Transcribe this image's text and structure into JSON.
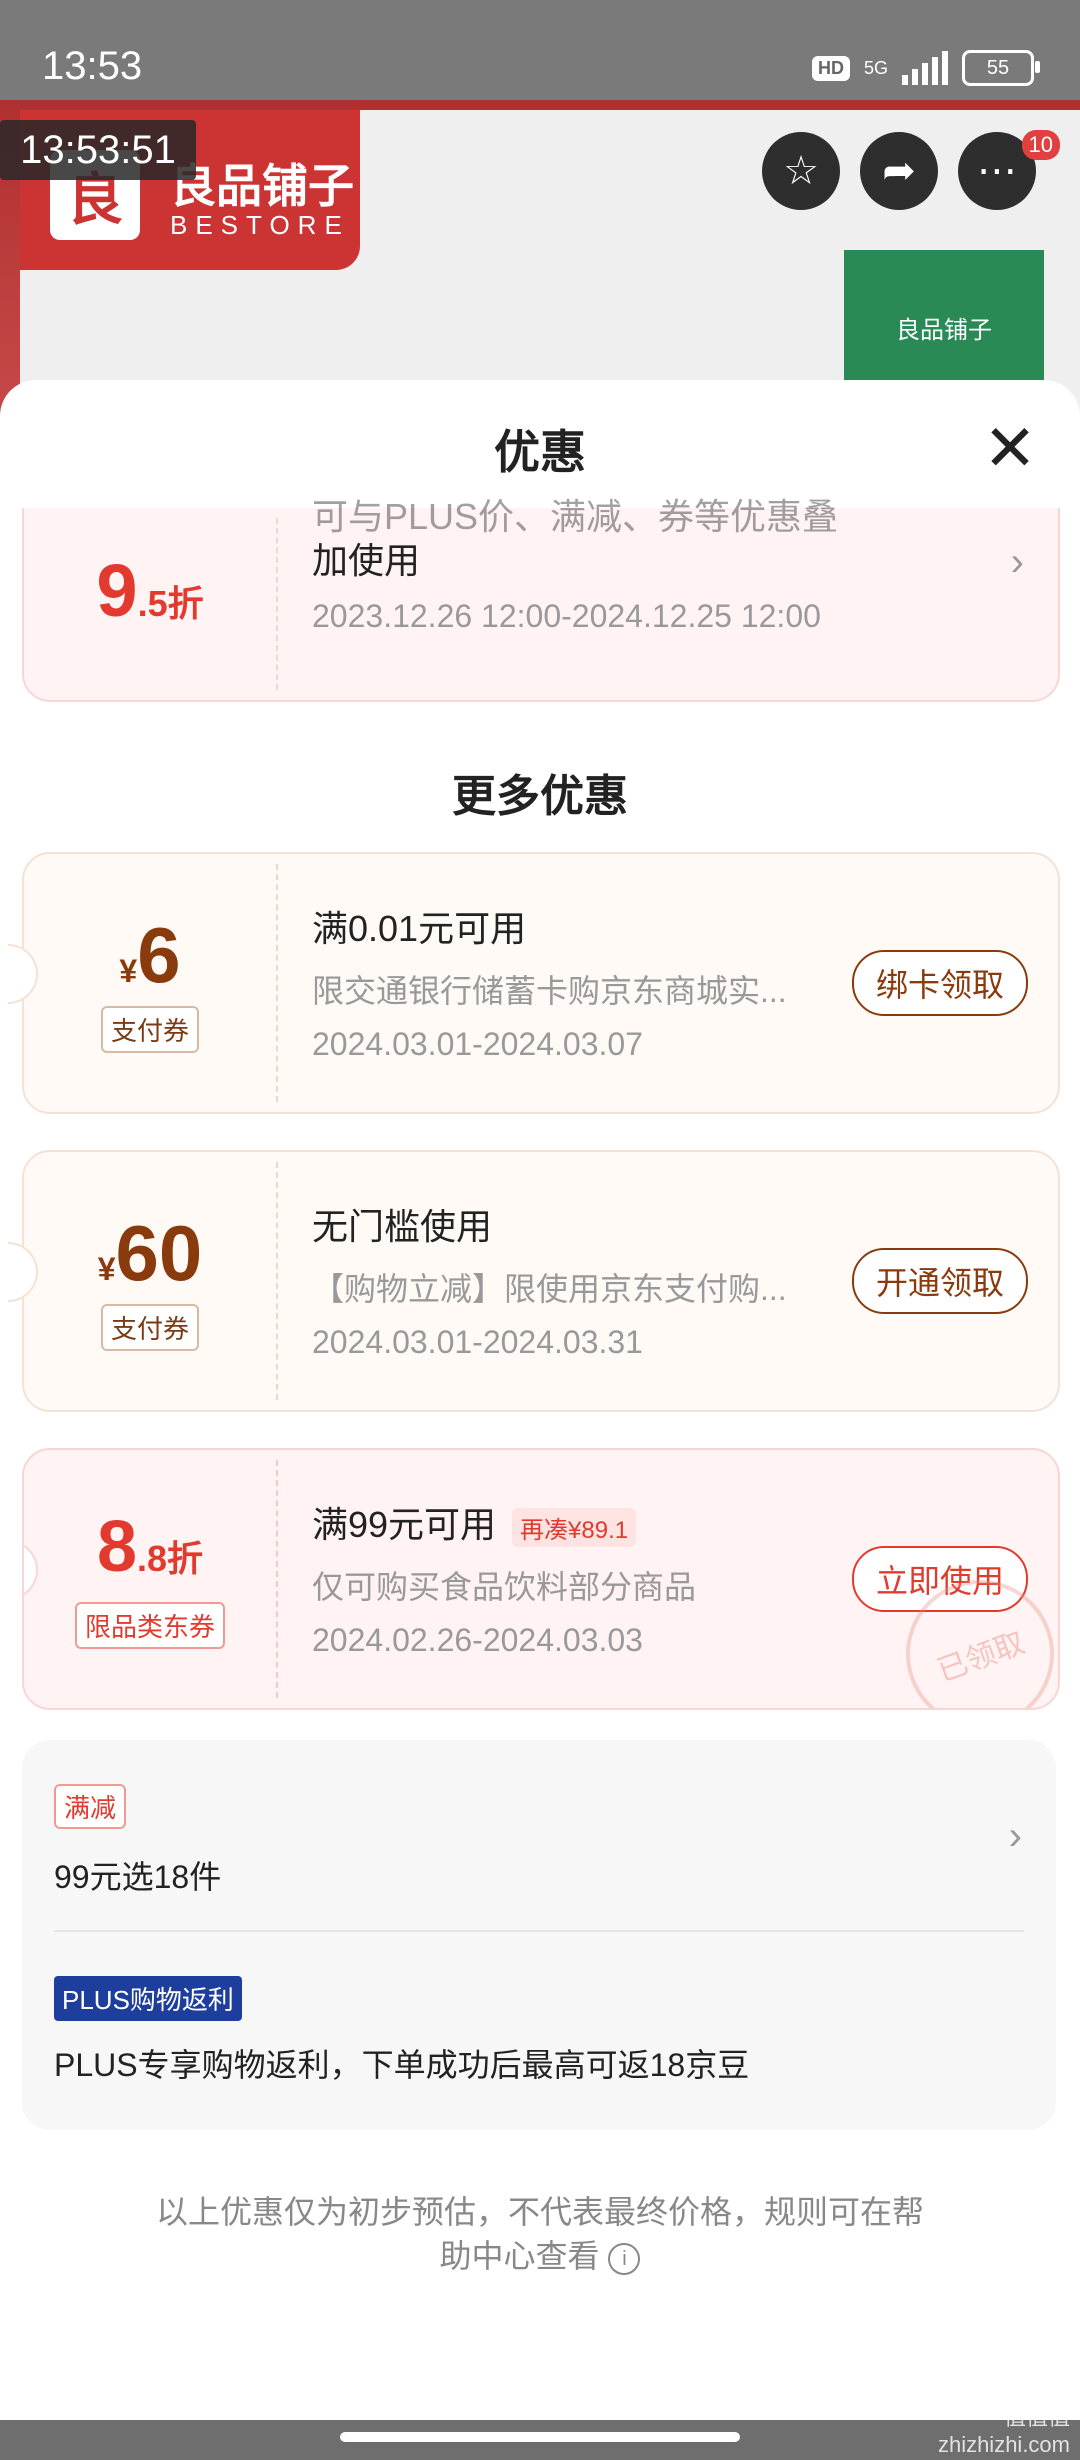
{
  "status_bar": {
    "time": "13:53",
    "hd": "HD",
    "network": "5G",
    "battery": "55"
  },
  "product": {
    "timer": "13:53:51",
    "brand_name": "良品铺子",
    "brand_sub": "BESTORE",
    "brand_logo_char": "良",
    "pack_label": "良品铺子",
    "more_badge": "10",
    "icons": {
      "favorite": "star-icon",
      "share": "share-icon",
      "more": "more-icon"
    }
  },
  "sheet": {
    "title": "优惠",
    "close": "✕",
    "top_coupon": {
      "amount_big": "9",
      "amount_small": ".5折",
      "desc_line1": "可与PLUS价、满减、券等优惠叠",
      "desc_line2": "加使用",
      "date": "2023.12.26 12:00-2024.12.25 12:00"
    },
    "more_title": "更多优惠",
    "coupons": [
      {
        "currency": "¥",
        "amount": "6",
        "tag": "支付券",
        "title": "满0.01元可用",
        "desc": "限交通银行储蓄卡购京东商城实...",
        "date": "2024.03.01-2024.03.07",
        "button": "绑卡领取"
      },
      {
        "currency": "¥",
        "amount": "60",
        "tag": "支付券",
        "title": "无门槛使用",
        "desc": "【购物立减】限使用京东支付购...",
        "date": "2024.03.01-2024.03.31",
        "button": "开通领取"
      },
      {
        "amount_big": "8",
        "amount_small": ".8折",
        "tag": "限品类东券",
        "title": "满99元可用",
        "again": "再凑¥89.1",
        "desc": "仅可购买食品饮料部分商品",
        "date": "2024.02.26-2024.03.03",
        "button": "立即使用",
        "stamp": "已领取"
      }
    ],
    "promo": {
      "badge1": "满减",
      "text1": "99元选18件",
      "badge2": "PLUS购物返利",
      "text2": "PLUS专享购物返利，下单成功后最高可返18京豆"
    },
    "footer_line1": "以上优惠仅为初步预估，不代表最终价格，规则可在帮",
    "footer_line2": "助中心查看",
    "info_icon": "i"
  },
  "watermark": {
    "line1": "值值值",
    "line2": "zhizhizhi.com"
  },
  "colors": {
    "brand_red": "#cc3333",
    "coupon_brown": "#8a3b0e",
    "coupon_red": "#e23a2e",
    "plus_blue": "#1d3e9c"
  }
}
